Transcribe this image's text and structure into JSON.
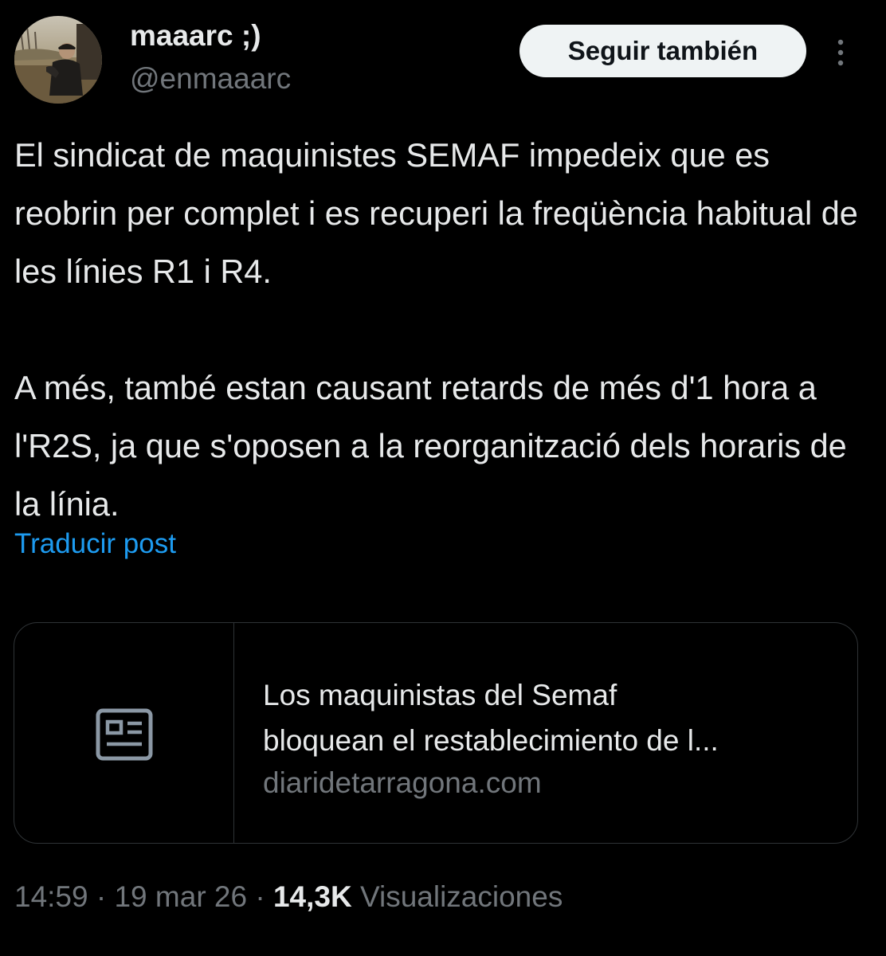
{
  "author": {
    "display_name": "maaarc ;)",
    "handle": "@enmaaarc"
  },
  "header": {
    "follow_label": "Seguir también",
    "more_icon": "more-vertical-icon"
  },
  "tweet": {
    "paragraphs": [
      "El sindicat de maquinistes SEMAF impedeix que es reobrin per complet i es recuperi la freqüència habitual de les línies R1 i R4.",
      "A més, també estan causant retards de més d'1 hora a l'R2S, ja que s'oposen a la reorganització dels horaris de la línia."
    ],
    "translate_label": "Traducir post"
  },
  "link_card": {
    "icon": "newspaper-icon",
    "title_lines": [
      "Los maquinistas del Semaf",
      "bloquean el restablecimiento de l..."
    ],
    "domain": "diaridetarragona.com"
  },
  "meta": {
    "time": "14:59",
    "separator": " · ",
    "date": "19 mar 26",
    "views_count": "14,3K",
    "views_label": "Visualizaciones"
  },
  "colors": {
    "background": "#000000",
    "text": "#e7e9ea",
    "muted": "#71767b",
    "link": "#1d9bf0",
    "border": "#2f3336",
    "button_bg": "#eff3f4"
  }
}
